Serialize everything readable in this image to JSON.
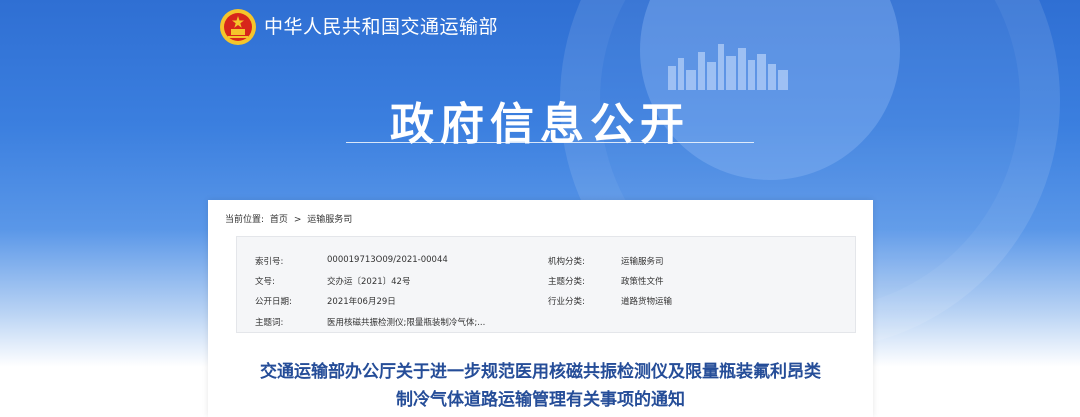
{
  "header": {
    "ministry_name": "中华人民共和国交通运输部",
    "page_title": "政府信息公开"
  },
  "breadcrumb": {
    "label": "当前位置:",
    "items": [
      "首页",
      ">",
      "运输服务司"
    ]
  },
  "meta": {
    "index_no": {
      "label": "索引号:",
      "value": "000019713O09/2021-00044"
    },
    "doc_no": {
      "label": "文号:",
      "value": "交办运〔2021〕42号"
    },
    "publish_date": {
      "label": "公开日期:",
      "value": "2021年06月29日"
    },
    "subject_words": {
      "label": "主题词:",
      "value": "医用核磁共振检测仪;限量瓶装制冷气体;..."
    },
    "org_category": {
      "label": "机构分类:",
      "value": "运输服务司"
    },
    "topic_category": {
      "label": "主题分类:",
      "value": "政策性文件"
    },
    "industry_category": {
      "label": "行业分类:",
      "value": "道路货物运输"
    }
  },
  "document": {
    "title_line1": "交通运输部办公厅关于进一步规范医用核磁共振检测仪及限量瓶装氟利昂类",
    "title_line2": "制冷气体道路运输管理有关事项的通知"
  },
  "colors": {
    "banner_blue": "#2f6fd3",
    "title_blue": "#254d98",
    "emblem_red": "#d7261b",
    "emblem_gold": "#f5c52b"
  }
}
